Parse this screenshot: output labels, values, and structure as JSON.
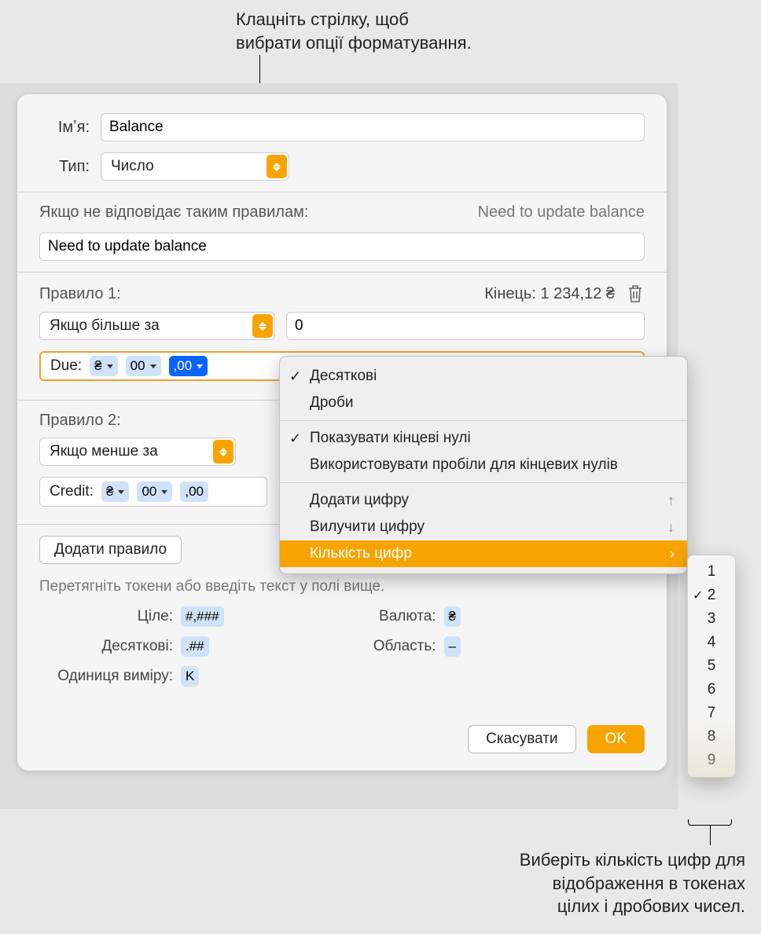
{
  "callouts": {
    "top": "Клацніть стрілку, щоб\nвибрати опції форматування.",
    "bottom": "Виберіть кількість цифр для\nвідображення в токенах\nцілих і дробових чисел."
  },
  "name_label": "Імʼя:",
  "name_value": "Balance",
  "type_label": "Тип:",
  "type_value": "Число",
  "no_match_label": "Якщо не відповідає таким правилам:",
  "no_match_preview": "Need to update balance",
  "no_match_value": "Need to update balance",
  "rule1": {
    "title": "Правило 1:",
    "end_label": "Кінець: 1 234,12 ₴",
    "cond": "Якщо більше за",
    "value": "0",
    "prefix": "Due:",
    "chips": {
      "currency": "₴",
      "integers": "00",
      "decimals": ",00"
    }
  },
  "rule2": {
    "title": "Правило 2:",
    "cond": "Якщо менше за",
    "prefix": "Credit:",
    "chips": {
      "currency": "₴",
      "integers": "00",
      "decimals": ",00"
    }
  },
  "add_rule": "Додати правило",
  "drag_hint": "Перетягніть токени або введіть текст у полі вище.",
  "tokens": {
    "integer_label": "Ціле:",
    "integer": "#,###",
    "decimal_label": "Десяткові:",
    "decimal": ".##",
    "unit_label": "Одиниця виміру:",
    "unit": "K",
    "currency_label": "Валюта:",
    "currency": "₴",
    "region_label": "Область:",
    "region": "–"
  },
  "buttons": {
    "cancel": "Скасувати",
    "ok": "OK"
  },
  "menu": {
    "decimals": "Десяткові",
    "fractions": "Дроби",
    "trailing_zeros": "Показувати кінцеві нулі",
    "spaces_for_zeros": "Використовувати пробіли для кінцевих нулів",
    "add_digit": "Додати цифру",
    "remove_digit": "Вилучити цифру",
    "digit_count": "Кількість цифр"
  },
  "submenu": [
    "1",
    "2",
    "3",
    "4",
    "5",
    "6",
    "7",
    "8",
    "9"
  ],
  "submenu_selected": "2"
}
